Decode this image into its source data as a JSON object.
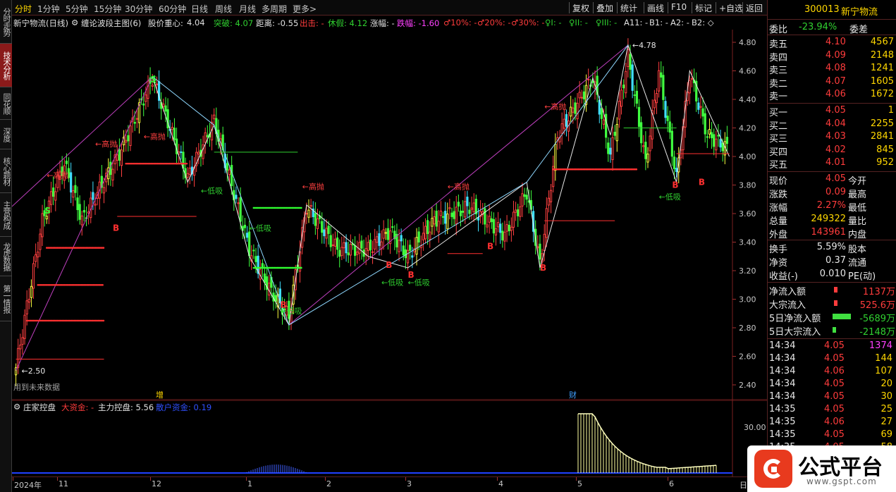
{
  "left_tabs": [
    {
      "label": "分时走势",
      "active": false
    },
    {
      "label": "技术分析",
      "active": true
    },
    {
      "label": "同花顺",
      "active": false
    },
    {
      "label": "深度F9",
      "active": false
    },
    {
      "label": "核心题材",
      "active": false
    },
    {
      "label": "主营构成",
      "active": false
    },
    {
      "label": "龙虎数据",
      "active": false
    },
    {
      "label": "第一情报",
      "active": false
    }
  ],
  "toolbar": {
    "periods": [
      "分时",
      "1分钟",
      "5分钟",
      "15分钟",
      "30分钟",
      "60分钟",
      "日线",
      "周线",
      "月线",
      "多周期",
      "更多>"
    ],
    "buttons": [
      "复权",
      "叠加",
      "统计",
      "画线",
      "F10",
      "标记",
      "+自选",
      "返回"
    ]
  },
  "indicator": {
    "stock": "新宁物流(日线)",
    "name": "缠论波段主图(6)",
    "center_label": "股价重心:",
    "center_value": "4.04",
    "breakout": "突破: 4.07",
    "distance": "距离: -0.55",
    "exit": "出击: -",
    "rest": "休假: 4.12",
    "rise": "涨幅: -",
    "fall": "跌幅: -1.60",
    "p10": "♂10%: -",
    "p20": "♂20%: -",
    "p30": "♂30%: -",
    "i1": "♀I: -",
    "i2": "♀II: -",
    "i3": "♀III: -",
    "a11": "A11: -",
    "b1": "B1: -",
    "a2": "A2: -",
    "b2": "B2: ◇"
  },
  "chart_data": {
    "type": "candlestick",
    "y_axis": {
      "min": 2.4,
      "max": 4.8,
      "ticks": [
        "4.80",
        "4.60",
        "4.40",
        "4.20",
        "4.00",
        "3.80",
        "3.60",
        "3.40",
        "3.20",
        "3.00",
        "2.80",
        "2.60",
        "2.40"
      ]
    },
    "x_axis": {
      "labels": [
        "2024年",
        "11",
        "12",
        "1",
        "2",
        "3",
        "4",
        "5",
        "6",
        "日"
      ]
    },
    "low_label": "2.50",
    "high_label": "4.78",
    "annotations": [
      "←高抛",
      "←高抛",
      "←高抛",
      "←高抛",
      "←高抛",
      "←高抛",
      "←低吸",
      "←低吸",
      "←低吸",
      "←低吸",
      "←低吸",
      "←低吸"
    ],
    "event_markers": [
      "增",
      "财"
    ],
    "sub_chart": {
      "title": "庄家控盘",
      "big_money": "大资金: -",
      "main_control": "主力控盘: 5.56",
      "retail": "散户资金: 0.19",
      "y_ticks": [
        "30.00",
        "15"
      ]
    }
  },
  "future_note": "用到未来数据",
  "quote": {
    "code": "300013",
    "name": "新宁物流",
    "weibi_label": "委比",
    "weibi_value": "-23.94%",
    "weicha_label": "委差",
    "sells": [
      {
        "label": "卖五",
        "price": "4.10",
        "vol": "4567"
      },
      {
        "label": "卖四",
        "price": "4.09",
        "vol": "2148"
      },
      {
        "label": "卖三",
        "price": "4.08",
        "vol": "1241"
      },
      {
        "label": "卖二",
        "price": "4.07",
        "vol": "1605"
      },
      {
        "label": "卖一",
        "price": "4.06",
        "vol": "1672"
      }
    ],
    "buys": [
      {
        "label": "买一",
        "price": "4.05",
        "vol": "1"
      },
      {
        "label": "买二",
        "price": "4.04",
        "vol": "2255"
      },
      {
        "label": "买三",
        "price": "4.03",
        "vol": "2841"
      },
      {
        "label": "买四",
        "price": "4.02",
        "vol": "845"
      },
      {
        "label": "买五",
        "price": "4.01",
        "vol": "952"
      }
    ],
    "stats": [
      {
        "l1": "现价",
        "v1": "4.05",
        "c1": "red",
        "l2": "今开"
      },
      {
        "l1": "涨跌",
        "v1": "0.09",
        "c1": "red",
        "l2": "最高"
      },
      {
        "l1": "涨幅",
        "v1": "2.27%",
        "c1": "red",
        "l2": "最低"
      },
      {
        "l1": "总量",
        "v1": "249322",
        "c1": "yellow",
        "l2": "量比"
      },
      {
        "l1": "外盘",
        "v1": "143961",
        "c1": "red",
        "l2": "内盘"
      }
    ],
    "stats2": [
      {
        "l1": "换手",
        "v1": "5.59%",
        "l2": "股本"
      },
      {
        "l1": "净资",
        "v1": "0.37",
        "l2": "流通"
      },
      {
        "l1": "收益(-)",
        "v1": "0.010",
        "l2": "PE(动)"
      }
    ],
    "flows": [
      {
        "label": "净流入额",
        "value": "1137万",
        "color": "red"
      },
      {
        "label": "大宗流入",
        "value": "525.6万",
        "color": "red"
      },
      {
        "label": "5日净流入额",
        "value": "-5689万",
        "color": "green"
      },
      {
        "label": "5日大宗流入",
        "value": "-2148万",
        "color": "green"
      }
    ],
    "ticks": [
      {
        "time": "14:34",
        "price": "4.05",
        "vol": "1374",
        "vc": "magenta"
      },
      {
        "time": "14:34",
        "price": "4.05",
        "vol": "144",
        "vc": "yellow"
      },
      {
        "time": "14:34",
        "price": "4.06",
        "vol": "107",
        "vc": "yellow"
      },
      {
        "time": "14:34",
        "price": "4.05",
        "vol": "20",
        "vc": "yellow"
      },
      {
        "time": "14:34",
        "price": "4.05",
        "vol": "30",
        "vc": "yellow"
      },
      {
        "time": "14:35",
        "price": "4.05",
        "vol": "25",
        "vc": "yellow"
      },
      {
        "time": "14:35",
        "price": "4.06",
        "vol": "27",
        "vc": "yellow"
      },
      {
        "time": "14:35",
        "price": "4.05",
        "vol": "69",
        "vc": "yellow"
      },
      {
        "time": "14:35",
        "price": "4.05",
        "vol": "58",
        "vc": "yellow"
      }
    ]
  },
  "logo": {
    "text": "公式平台",
    "url": "www.gspt.com"
  }
}
